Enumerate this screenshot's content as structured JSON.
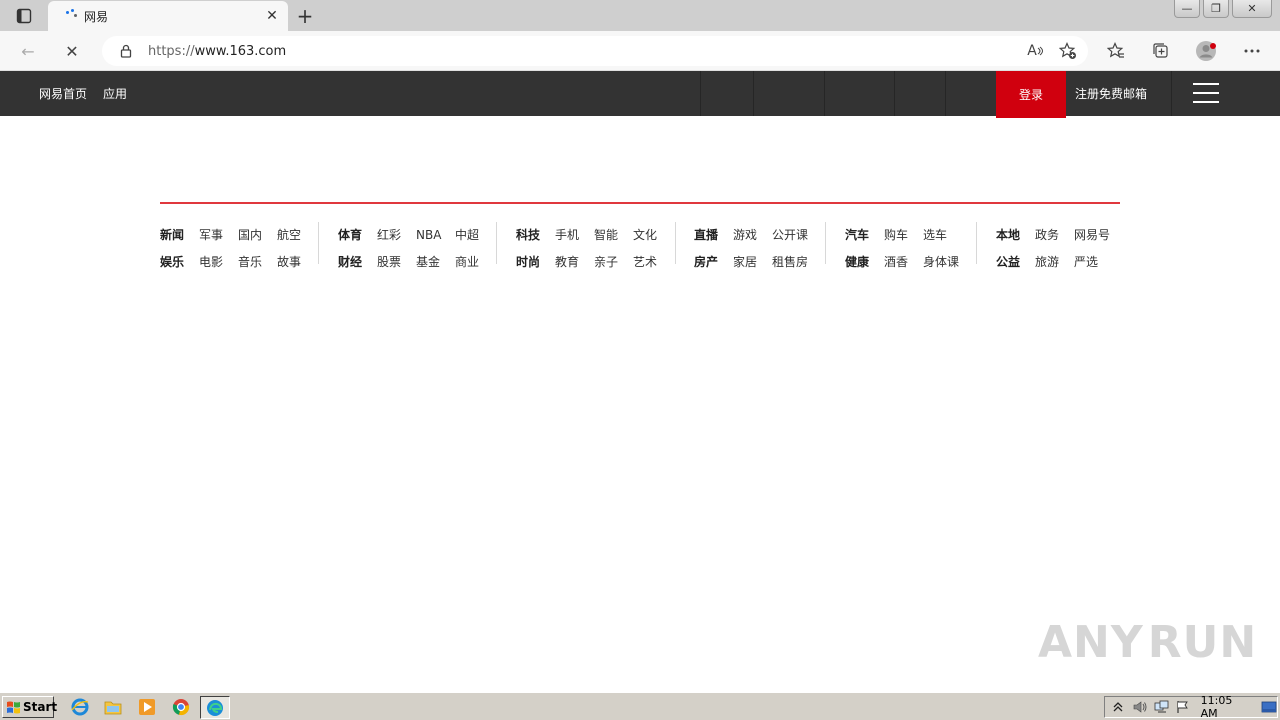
{
  "browser": {
    "tab_title": "网易",
    "close_glyph": "✕",
    "new_tab_glyph": "+",
    "url_scheme": "https://",
    "url_host": "www.163.com",
    "back_glyph": "←",
    "stop_glyph": "✕",
    "window": {
      "minimize": "—",
      "restore": "❐",
      "close": "✕"
    },
    "read_aloud": "A"
  },
  "topnav": {
    "home": "网易首页",
    "apps": "应用",
    "login": "登录",
    "register": "注册免费邮箱"
  },
  "categories": [
    {
      "rows": [
        [
          "新闻",
          "军事",
          "国内",
          "航空"
        ],
        [
          "娱乐",
          "电影",
          "音乐",
          "故事"
        ]
      ]
    },
    {
      "rows": [
        [
          "体育",
          "红彩",
          "NBA",
          "中超"
        ],
        [
          "财经",
          "股票",
          "基金",
          "商业"
        ]
      ]
    },
    {
      "rows": [
        [
          "科技",
          "手机",
          "智能",
          "文化"
        ],
        [
          "时尚",
          "教育",
          "亲子",
          "艺术"
        ]
      ]
    },
    {
      "rows": [
        [
          "直播",
          "游戏",
          "公开课"
        ],
        [
          "房产",
          "家居",
          "租售房"
        ]
      ]
    },
    {
      "rows": [
        [
          "汽车",
          "购车",
          "选车"
        ],
        [
          "健康",
          "酒香",
          "身体课"
        ]
      ]
    },
    {
      "rows": [
        [
          "本地",
          "政务",
          "网易号"
        ],
        [
          "公益",
          "旅游",
          "严选"
        ]
      ]
    }
  ],
  "watermark": {
    "left": "ANY",
    "right": "RUN"
  },
  "taskbar": {
    "start": "Start",
    "clock": "11:05 AM"
  },
  "colors": {
    "accent_red": "#d0000e",
    "nav_bg": "#333333",
    "divider_red": "#e0383e"
  }
}
